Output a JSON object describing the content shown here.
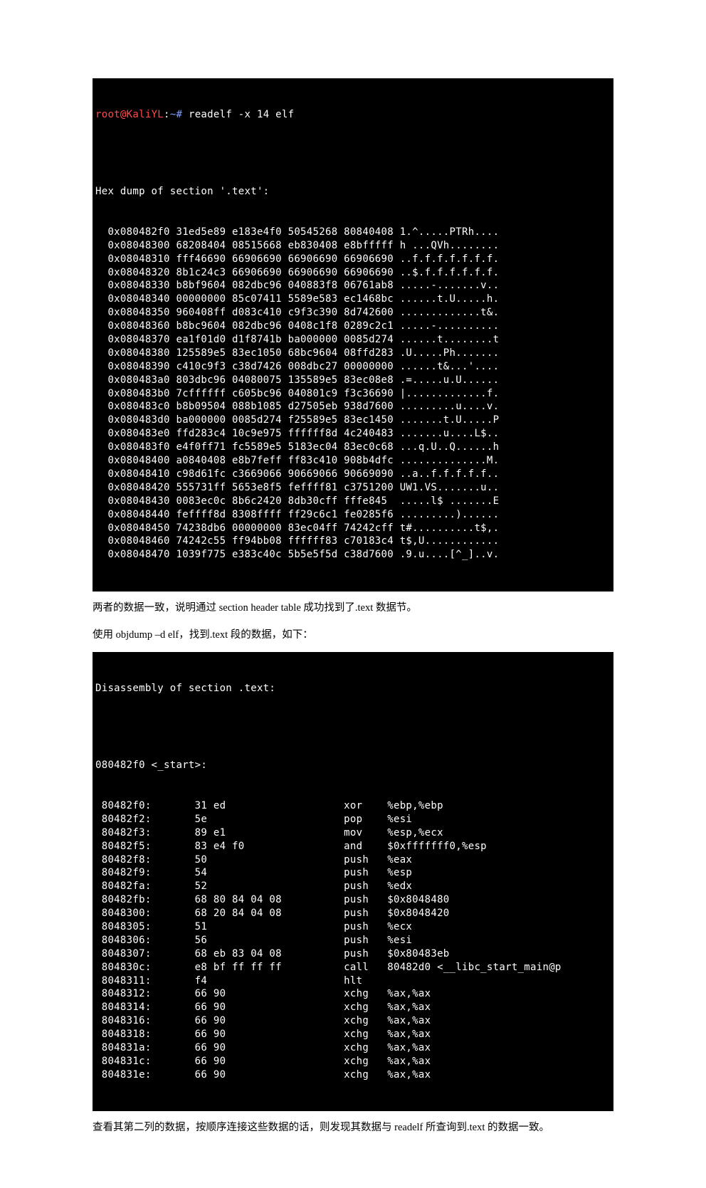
{
  "prompt": {
    "user": "root",
    "at": "@",
    "host": "KaliYL",
    "colon": ":",
    "path": "~#",
    "cmd": " readelf -x 14 elf"
  },
  "hex_header": "Hex dump of section '.text':",
  "hex_rows": [
    {
      "a": "  0x080482f0",
      "b": " 31ed5e89 e183e4f0 50545268 80840408",
      "c": " 1.^.....PTRh...."
    },
    {
      "a": "  0x08048300",
      "b": " 68208404 08515668 eb830408 e8bfffff",
      "c": " h ...QVh........"
    },
    {
      "a": "  0x08048310",
      "b": " fff46690 66906690 66906690 66906690",
      "c": " ..f.f.f.f.f.f.f."
    },
    {
      "a": "  0x08048320",
      "b": " 8b1c24c3 66906690 66906690 66906690",
      "c": " ..$.f.f.f.f.f.f."
    },
    {
      "a": "  0x08048330",
      "b": " b8bf9604 082dbc96 040883f8 06761ab8",
      "c": " .....-.......v.."
    },
    {
      "a": "  0x08048340",
      "b": " 00000000 85c07411 5589e583 ec1468bc",
      "c": " ......t.U.....h."
    },
    {
      "a": "  0x08048350",
      "b": " 960408ff d083c410 c9f3c390 8d742600",
      "c": " .............t&."
    },
    {
      "a": "  0x08048360",
      "b": " b8bc9604 082dbc96 0408c1f8 0289c2c1",
      "c": " .....-.........."
    },
    {
      "a": "  0x08048370",
      "b": " ea1f01d0 d1f8741b ba000000 0085d274",
      "c": " ......t........t"
    },
    {
      "a": "  0x08048380",
      "b": " 125589e5 83ec1050 68bc9604 08ffd283",
      "c": " .U.....Ph......."
    },
    {
      "a": "  0x08048390",
      "b": " c410c9f3 c38d7426 008dbc27 00000000",
      "c": " ......t&...'...."
    },
    {
      "a": "  0x080483a0",
      "b": " 803dbc96 04080075 135589e5 83ec08e8",
      "c": " .=.....u.U......"
    },
    {
      "a": "  0x080483b0",
      "b": " 7cffffff c605bc96 040801c9 f3c36690",
      "c": " |.............f."
    },
    {
      "a": "  0x080483c0",
      "b": " b8b09504 088b1085 d27505eb 938d7600",
      "c": " .........u....v."
    },
    {
      "a": "  0x080483d0",
      "b": " ba000000 0085d274 f25589e5 83ec1450",
      "c": " .......t.U.....P"
    },
    {
      "a": "  0x080483e0",
      "b": " ffd283c4 10c9e975 ffffff8d 4c240483",
      "c": " .......u....L$.."
    },
    {
      "a": "  0x080483f0",
      "b": " e4f0ff71 fc5589e5 5183ec04 83ec0c68",
      "c": " ...q.U..Q......h"
    },
    {
      "a": "  0x08048400",
      "b": " a0840408 e8b7feff ff83c410 908b4dfc",
      "c": " ..............M."
    },
    {
      "a": "  0x08048410",
      "b": " c98d61fc c3669066 90669066 90669090",
      "c": " ..a..f.f.f.f.f.."
    },
    {
      "a": "  0x08048420",
      "b": " 555731ff 5653e8f5 feffff81 c3751200",
      "c": " UW1.VS.......u.."
    },
    {
      "a": "  0x08048430",
      "b": " 0083ec0c 8b6c2420 8db30cff fffe845 ",
      "c": " .....l$ .......E"
    },
    {
      "a": "  0x08048440",
      "b": " feffff8d 8308ffff ff29c6c1 fe0285f6",
      "c": " .........)......"
    },
    {
      "a": "  0x08048450",
      "b": " 74238db6 00000000 83ec04ff 74242cff",
      "c": " t#..........t$,."
    },
    {
      "a": "  0x08048460",
      "b": " 74242c55 ff94bb08 ffffff83 c70183c4",
      "c": " t$,U............"
    },
    {
      "a": "  0x08048470",
      "b": " 1039f775 e383c40c 5b5e5f5d c38d7600",
      "c": " .9.u....[^_]..v."
    }
  ],
  "para1": "两者的数据一致，说明通过 section header table 成功找到了.text 数据节。",
  "para2": "使用 objdump –d elf，找到.text 段的数据，如下：",
  "asm_header": "Disassembly of section .text:",
  "asm_label": "080482f0 <_start>:",
  "asm_rows": [
    {
      "addr": " 80482f0:",
      "bytes": "       31 ed                   ",
      "mn": "xor    ",
      "ops": "%ebp,%ebp"
    },
    {
      "addr": " 80482f2:",
      "bytes": "       5e                      ",
      "mn": "pop    ",
      "ops": "%esi"
    },
    {
      "addr": " 80482f3:",
      "bytes": "       89 e1                   ",
      "mn": "mov    ",
      "ops": "%esp,%ecx"
    },
    {
      "addr": " 80482f5:",
      "bytes": "       83 e4 f0                ",
      "mn": "and    ",
      "ops": "$0xfffffff0,%esp"
    },
    {
      "addr": " 80482f8:",
      "bytes": "       50                      ",
      "mn": "push   ",
      "ops": "%eax"
    },
    {
      "addr": " 80482f9:",
      "bytes": "       54                      ",
      "mn": "push   ",
      "ops": "%esp"
    },
    {
      "addr": " 80482fa:",
      "bytes": "       52                      ",
      "mn": "push   ",
      "ops": "%edx"
    },
    {
      "addr": " 80482fb:",
      "bytes": "       68 80 84 04 08          ",
      "mn": "push   ",
      "ops": "$0x8048480"
    },
    {
      "addr": " 8048300:",
      "bytes": "       68 20 84 04 08          ",
      "mn": "push   ",
      "ops": "$0x8048420"
    },
    {
      "addr": " 8048305:",
      "bytes": "       51                      ",
      "mn": "push   ",
      "ops": "%ecx"
    },
    {
      "addr": " 8048306:",
      "bytes": "       56                      ",
      "mn": "push   ",
      "ops": "%esi"
    },
    {
      "addr": " 8048307:",
      "bytes": "       68 eb 83 04 08          ",
      "mn": "push   ",
      "ops": "$0x80483eb"
    },
    {
      "addr": " 804830c:",
      "bytes": "       e8 bf ff ff ff          ",
      "mn": "call   ",
      "ops": "80482d0 <__libc_start_main@p"
    },
    {
      "addr": " 8048311:",
      "bytes": "       f4                      ",
      "mn": "hlt    ",
      "ops": ""
    },
    {
      "addr": " 8048312:",
      "bytes": "       66 90                   ",
      "mn": "xchg   ",
      "ops": "%ax,%ax"
    },
    {
      "addr": " 8048314:",
      "bytes": "       66 90                   ",
      "mn": "xchg   ",
      "ops": "%ax,%ax"
    },
    {
      "addr": " 8048316:",
      "bytes": "       66 90                   ",
      "mn": "xchg   ",
      "ops": "%ax,%ax"
    },
    {
      "addr": " 8048318:",
      "bytes": "       66 90                   ",
      "mn": "xchg   ",
      "ops": "%ax,%ax"
    },
    {
      "addr": " 804831a:",
      "bytes": "       66 90                   ",
      "mn": "xchg   ",
      "ops": "%ax,%ax"
    },
    {
      "addr": " 804831c:",
      "bytes": "       66 90                   ",
      "mn": "xchg   ",
      "ops": "%ax,%ax"
    },
    {
      "addr": " 804831e:",
      "bytes": "       66 90                   ",
      "mn": "xchg   ",
      "ops": "%ax,%ax"
    }
  ],
  "para3": "查看其第二列的数据，按顺序连接这些数据的话，则发现其数据与 readelf 所查询到.text 的数据一致。"
}
